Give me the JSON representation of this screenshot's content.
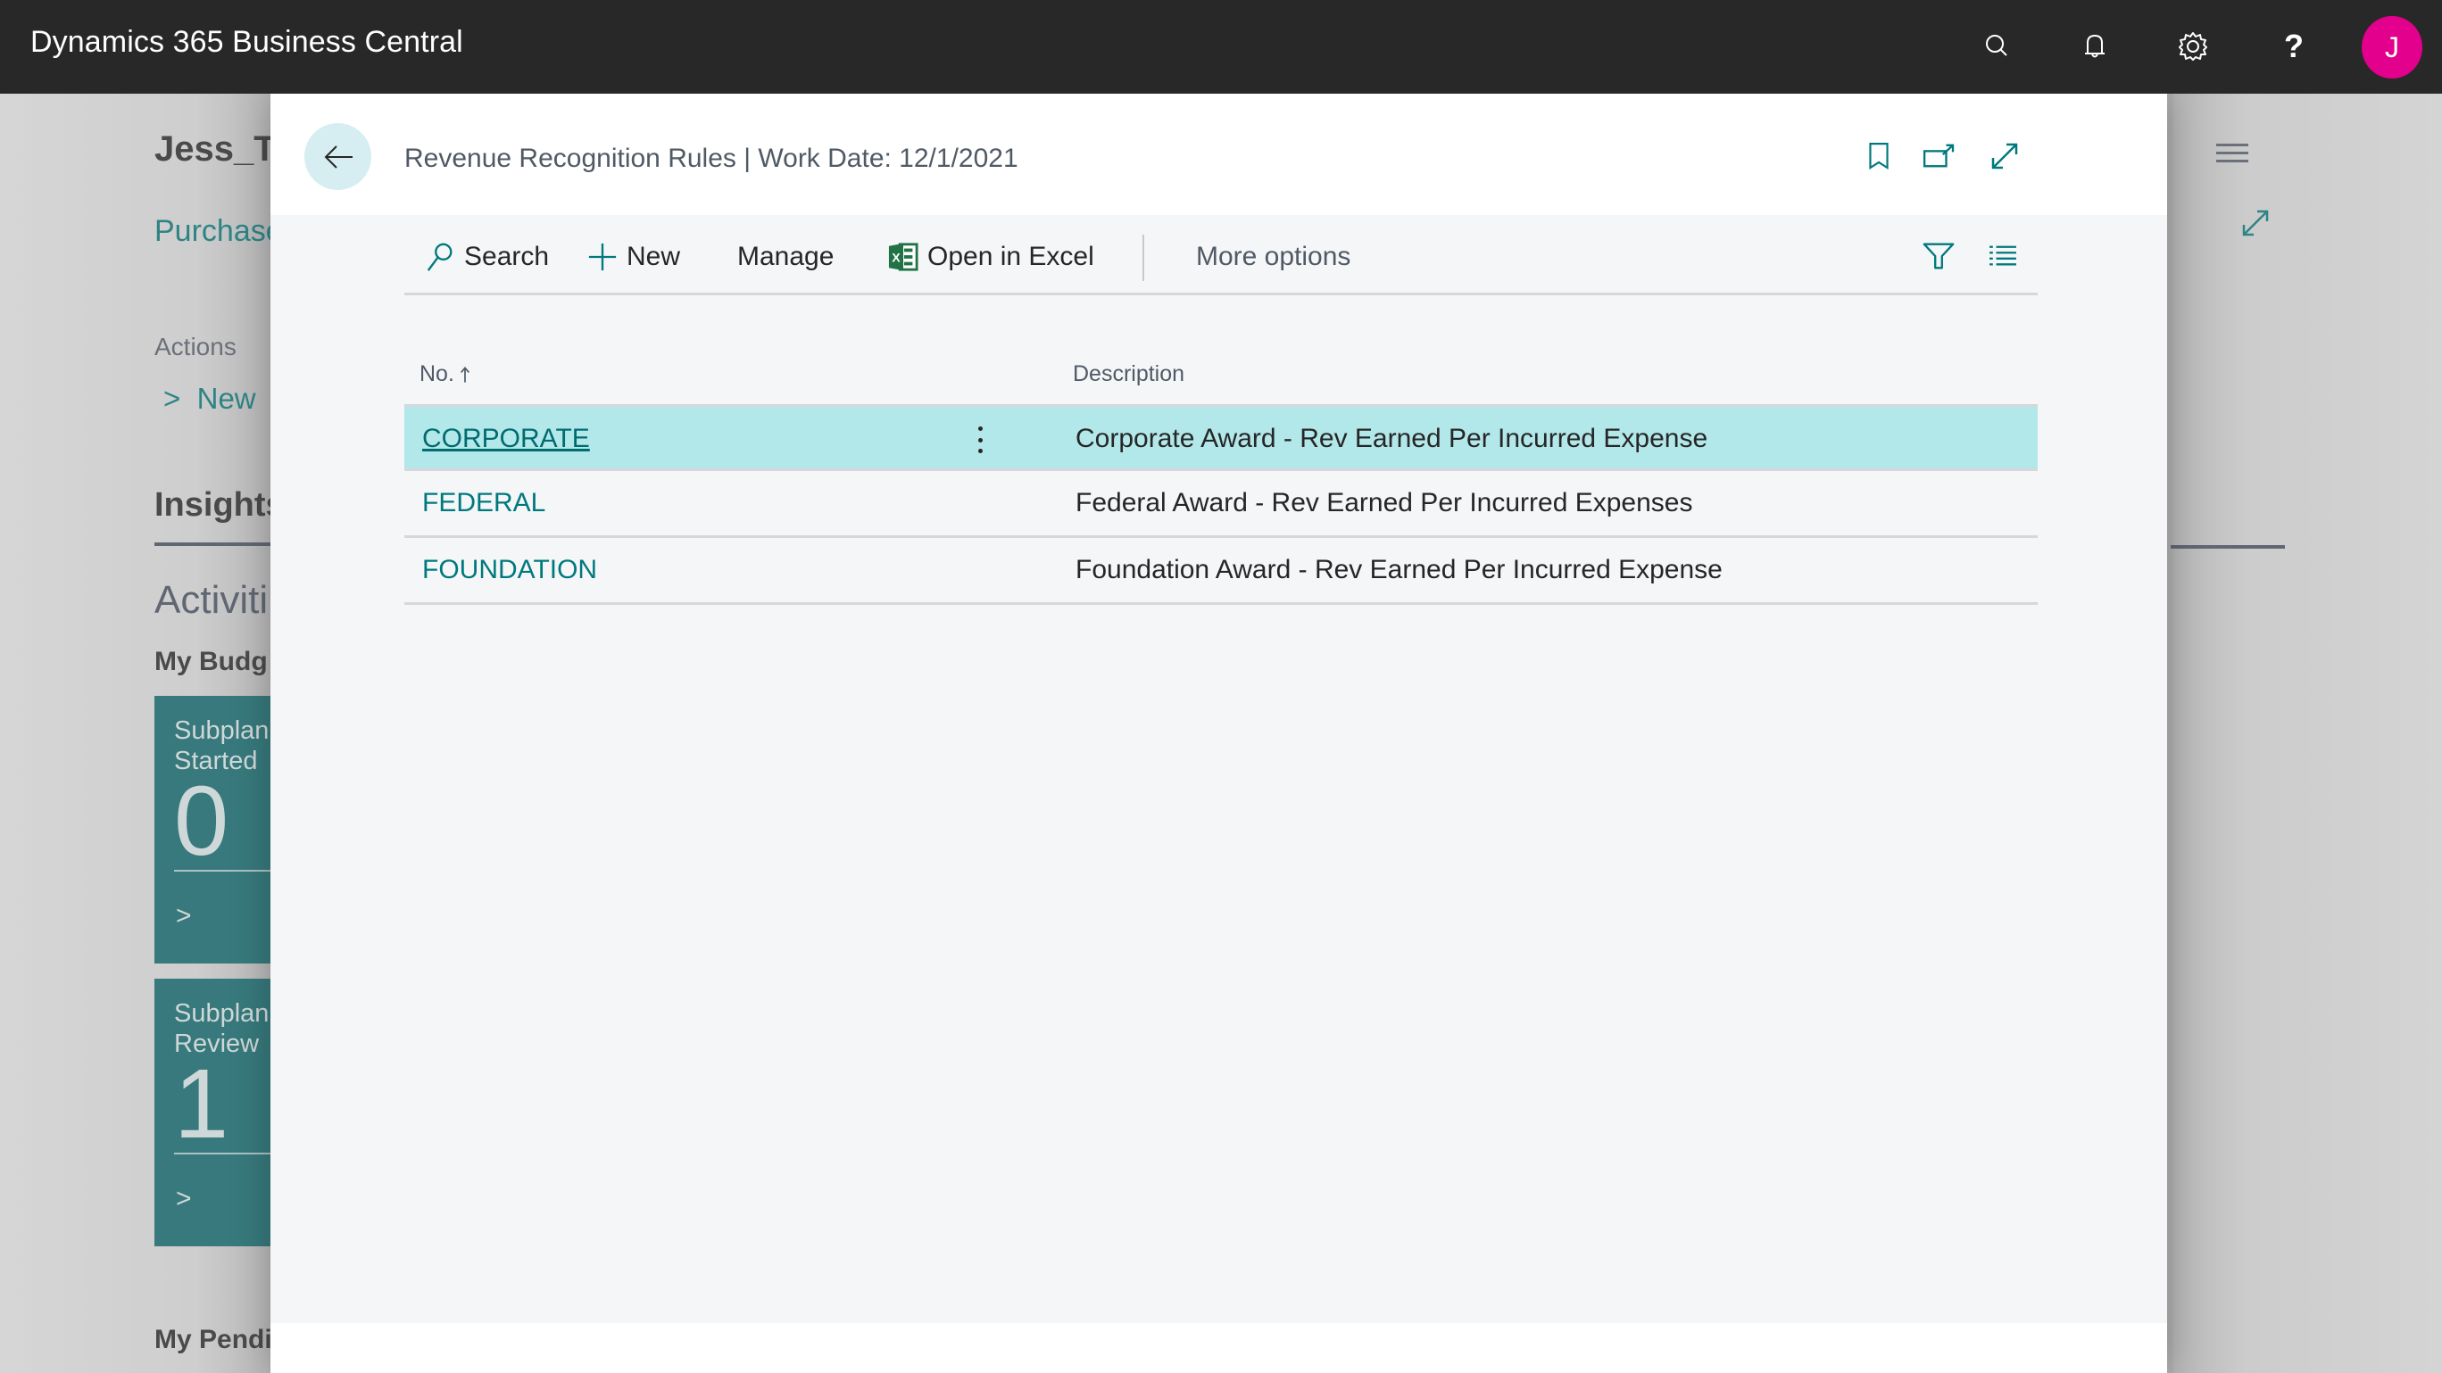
{
  "appbar": {
    "title": "Dynamics 365 Business Central",
    "icons": [
      "search-icon",
      "bell-icon",
      "gear-icon",
      "help-icon"
    ],
    "avatar_initial": "J",
    "avatar_color": "#e3008c"
  },
  "background_page": {
    "title": "Jess_Te",
    "link": "Purchase",
    "actions_label": "Actions",
    "new_action": "New",
    "insights_label": "Insights",
    "activities_label": "Activiti",
    "my_budget_label": "My Budg",
    "tiles": [
      {
        "label": "Subplan\nStarted",
        "value": "0"
      },
      {
        "label": "Subplan\nReview",
        "value": "1"
      }
    ],
    "my_pending_label": "My Pendi"
  },
  "dialog": {
    "title": "Revenue Recognition Rules | Work Date: 12/1/2021",
    "header_icons": [
      "bookmark-icon",
      "open-new-window-icon",
      "expand-icon"
    ],
    "toolbar": {
      "search": "Search",
      "new": "New",
      "manage": "Manage",
      "open_in_excel": "Open in Excel",
      "more_options": "More options"
    },
    "table": {
      "columns": [
        {
          "label": "No.",
          "sort": "ascending"
        },
        {
          "label": "Description"
        }
      ],
      "rows": [
        {
          "no": "CORPORATE",
          "description": "Corporate Award - Rev Earned Per Incurred Expense",
          "selected": true
        },
        {
          "no": "FEDERAL",
          "description": "Federal Award - Rev Earned Per Incurred Expenses",
          "selected": false
        },
        {
          "no": "FOUNDATION",
          "description": "Foundation Award - Rev Earned Per Incurred Expense",
          "selected": false
        }
      ]
    }
  },
  "colors": {
    "accent": "#00797d",
    "selected_row": "#b3e8eb",
    "appbar": "#282828",
    "tile": "#37797c"
  }
}
